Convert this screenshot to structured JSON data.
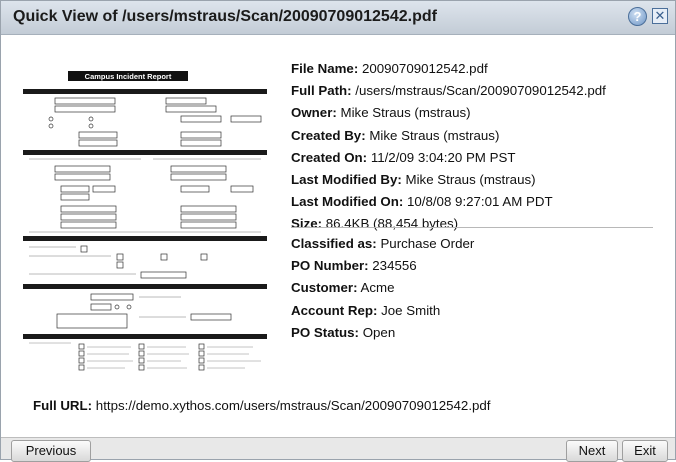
{
  "dialog": {
    "title": "Quick View of /users/mstraus/Scan/20090709012542.pdf",
    "help_icon": "help-icon",
    "close_icon": "close-icon",
    "help_glyph": "?",
    "close_glyph": "✕"
  },
  "preview": {
    "doc_title": "Campus Incident Report"
  },
  "metadata": [
    {
      "label": "File Name:",
      "value": "20090709012542.pdf"
    },
    {
      "label": "Full Path:",
      "value": "/users/mstraus/Scan/20090709012542.pdf"
    },
    {
      "label": "Owner:",
      "value": "Mike Straus (mstraus)"
    },
    {
      "label": "Created By:",
      "value": "Mike Straus (mstraus)"
    },
    {
      "label": "Created On:",
      "value": "11/2/09 3:04:20 PM PST"
    },
    {
      "label": "Last Modified By:",
      "value": "Mike Straus (mstraus)"
    },
    {
      "label": "Last Modified On:",
      "value": "10/8/08 9:27:01 AM PDT"
    },
    {
      "label": "Size:",
      "value": "86.4KB (88,454 bytes)"
    }
  ],
  "classification": [
    {
      "label": "Classified as:",
      "value": "Purchase Order"
    },
    {
      "label": "PO Number:",
      "value": "234556"
    },
    {
      "label": "Customer:",
      "value": "Acme"
    },
    {
      "label": "Account Rep:",
      "value": "Joe Smith"
    },
    {
      "label": "PO Status:",
      "value": "Open"
    }
  ],
  "full_url": {
    "label": "Full URL:",
    "value": "https://demo.xythos.com/users/mstraus/Scan/20090709012542.pdf"
  },
  "footer": {
    "previous_label": "Previous",
    "next_label": "Next",
    "exit_label": "Exit"
  }
}
